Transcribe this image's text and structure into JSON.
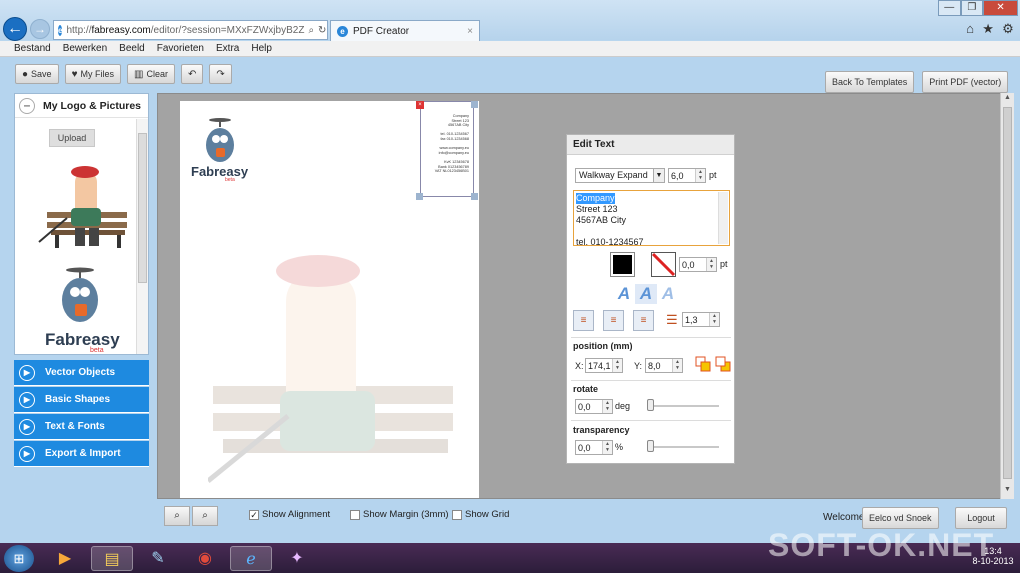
{
  "browser": {
    "url_prefix": "http://",
    "url_domain": "fabreasy.com",
    "url_rest": "/editor/?session=MXxFZWxjbyB2Z",
    "tab_title": "PDF Creator",
    "tab_close": "×",
    "window_buttons": [
      "—",
      "❐",
      "✕"
    ],
    "right_icons": [
      "⌂",
      "★",
      "⚙"
    ],
    "menu": [
      "Bestand",
      "Bewerken",
      "Beeld",
      "Favorieten",
      "Extra",
      "Help"
    ]
  },
  "toolbar": {
    "save": "Save",
    "my_files": "My Files",
    "clear": "Clear",
    "undo_glyph": "↶",
    "redo_glyph": "↷",
    "back_to_templates": "Back To Templates",
    "print_pdf": "Print PDF (vector)"
  },
  "left_panel": {
    "section_title": "My Logo & Pictures",
    "collapse_glyph": "–",
    "upload_label": "Upload",
    "logo_text": "Fabreasy",
    "logo_tag": "beta",
    "accordion": [
      "Vector Objects",
      "Basic Shapes",
      "Text & Fonts",
      "Export & Import"
    ],
    "accordion_glyph": "▶"
  },
  "canvas": {
    "logo_text": "Fabreasy",
    "logo_tag": "beta",
    "address_lines": [
      "Company",
      "Street 123",
      "4567AB City",
      "",
      "tel. 010-1234567",
      "fax 010-1234568",
      "",
      "www.company.eu",
      "info@company.eu",
      "",
      "KvK 12345678",
      "Bank 0123456789",
      "VAT NL0123456B01"
    ]
  },
  "edit_text": {
    "title": "Edit Text",
    "font": "Walkway Expand",
    "font_size": "6,0",
    "font_unit": "pt",
    "text_lines": [
      "Company",
      "Street 123",
      "4567AB City",
      "",
      "tel. 010-1234567"
    ],
    "stroke_width": "0,0",
    "stroke_unit": "pt",
    "line_spacing": "1,3",
    "position_label": "position (mm)",
    "x_label": "X:",
    "x_value": "174,1",
    "y_label": "Y:",
    "y_value": "8,0",
    "rotate_label": "rotate",
    "rotate_value": "0,0",
    "rotate_unit": "deg",
    "rotate_level": 0,
    "transparency_label": "transparency",
    "transparency_value": "0,0",
    "transparency_unit": "%",
    "transparency_level": 0,
    "fill_color": "#000000",
    "text_styles": [
      "A",
      "A",
      "A"
    ]
  },
  "bottom": {
    "show_alignment": "Show Alignment",
    "show_alignment_checked": true,
    "show_margin": "Show Margin (3mm)",
    "show_grid": "Show Grid",
    "welcome": "Welcome",
    "user": "Eelco vd Snoek",
    "logout": "Logout"
  },
  "taskbar": {
    "clock_time": "13:4",
    "clock_date": "8-10-2013",
    "watermark": "SOFT-OK.NET"
  }
}
